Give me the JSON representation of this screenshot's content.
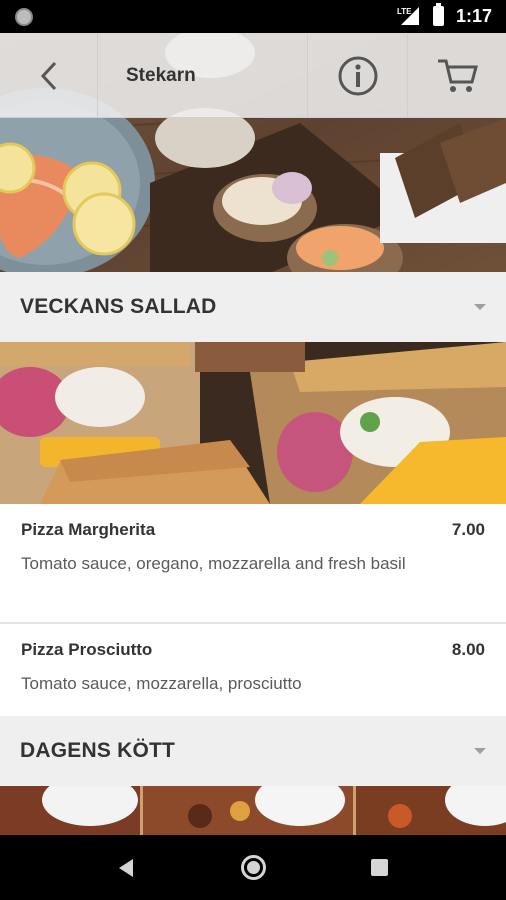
{
  "status_bar": {
    "time": "1:17",
    "network": "LTE"
  },
  "toolbar": {
    "title": "Stekarn"
  },
  "sections": [
    {
      "title": "VECKANS SALLAD",
      "items": [
        {
          "name": "Pizza Margherita",
          "price": "7.00",
          "description": "Tomato sauce, oregano, mozzarella and fresh basil"
        },
        {
          "name": "Pizza Prosciutto",
          "price": "8.00",
          "description": "Tomato sauce, mozzarella, prosciutto"
        }
      ]
    },
    {
      "title": "DAGENS KÖTT"
    }
  ],
  "icons": {
    "back": "chevron-left-icon",
    "info": "info-icon",
    "cart": "cart-icon",
    "section_toggle": "caret-down-icon"
  },
  "colors": {
    "toolbar_bg": "#eeeeee",
    "section_bg": "#efefef",
    "text_primary": "#333333",
    "text_secondary": "#5a5a5a"
  }
}
